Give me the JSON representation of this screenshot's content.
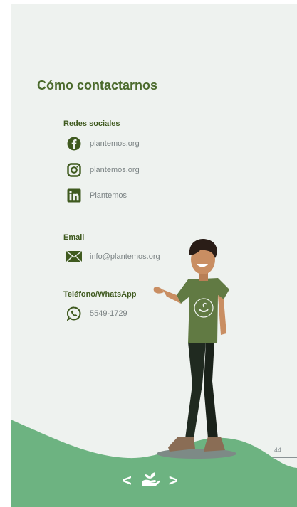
{
  "title": "Cómo contactarnos",
  "social": {
    "label": "Redes sociales",
    "items": [
      {
        "icon": "facebook-icon",
        "text": "plantemos.org"
      },
      {
        "icon": "instagram-icon",
        "text": "plantemos.org"
      },
      {
        "icon": "linkedin-icon",
        "text": "Plantemos"
      }
    ]
  },
  "email": {
    "label": "Email",
    "icon": "envelope-icon",
    "text": "info@plantemos.org"
  },
  "phone": {
    "label": "Teléfono/WhatsApp",
    "icon": "whatsapp-icon",
    "text": "5549-1729"
  },
  "page_number": "44",
  "nav": {
    "prev": "<",
    "next": ">",
    "logo_icon": "hand-sprout-icon"
  },
  "colors": {
    "accent": "#4b6a2c",
    "green": "#6db381",
    "background": "#eef2ef"
  }
}
